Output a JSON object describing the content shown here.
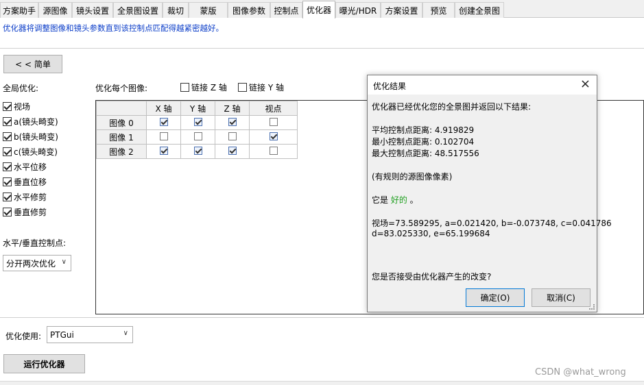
{
  "tabs": [
    {
      "label": "方案助手"
    },
    {
      "label": "源图像"
    },
    {
      "label": "镜头设置"
    },
    {
      "label": "全景图设置"
    },
    {
      "label": "裁切"
    },
    {
      "label": "蒙版"
    },
    {
      "label": "图像参数"
    },
    {
      "label": "控制点"
    },
    {
      "label": "优化器"
    },
    {
      "label": "曝光/HDR"
    },
    {
      "label": "方案设置"
    },
    {
      "label": "预览"
    },
    {
      "label": "创建全景图"
    }
  ],
  "active_tab": "优化器",
  "description": "优化器将调整图像和镜头参数直到该控制点匹配得越紧密越好。",
  "simple_button": "< < 简单",
  "global": {
    "label": "全局优化:",
    "options": [
      {
        "label": "视场",
        "checked": true
      },
      {
        "label": "a(镜头畸变)",
        "checked": true
      },
      {
        "label": "b(镜头畸变)",
        "checked": true
      },
      {
        "label": "c(镜头畸变)",
        "checked": true
      },
      {
        "label": "水平位移",
        "checked": true
      },
      {
        "label": "垂直位移",
        "checked": true
      },
      {
        "label": "水平修剪",
        "checked": true
      },
      {
        "label": "垂直修剪",
        "checked": true
      }
    ],
    "hv_label": "水平/垂直控制点:",
    "hv_value": "分开两次优化"
  },
  "per_image": {
    "label": "优化每个图像:",
    "link_z": {
      "label": "链接 Z 轴",
      "checked": false
    },
    "link_y": {
      "label": "链接 Y 轴",
      "checked": false
    },
    "columns": [
      "X 轴",
      "Y 轴",
      "Z 轴",
      "视点"
    ],
    "rows": [
      {
        "label": "图像 0",
        "values": [
          true,
          true,
          true,
          false
        ]
      },
      {
        "label": "图像 1",
        "values": [
          false,
          false,
          false,
          true
        ]
      },
      {
        "label": "图像 2",
        "values": [
          true,
          true,
          true,
          false
        ]
      }
    ]
  },
  "optimizer_use": {
    "label": "优化使用:",
    "value": "PTGui"
  },
  "run_button": "运行优化器",
  "dialog": {
    "title": "优化结果",
    "intro": "优化器已经优化您的全景图并返回以下结果:",
    "avg": "平均控制点距离: 4.919829",
    "min": "最小控制点距离: 0.102704",
    "max": "最大控制点距离: 48.517556",
    "note": "(有规则的源图像像素)",
    "verdict_prefix": "它是 ",
    "verdict_word": "好的",
    "verdict_suffix": " 。",
    "params1": "视场=73.589295, a=0.021420, b=-0.073748, c=0.041786",
    "params2": "d=83.025330, e=65.199684",
    "question": "您是否接受由优化器产生的改变?",
    "ok": "确定(O)",
    "cancel": "取消(C)",
    "close_icon": "×"
  },
  "watermark": "CSDN @what_wrong",
  "colors": {
    "description": "#0a3cc8",
    "good": "#22a022",
    "default_button_border": "#0078d7"
  }
}
